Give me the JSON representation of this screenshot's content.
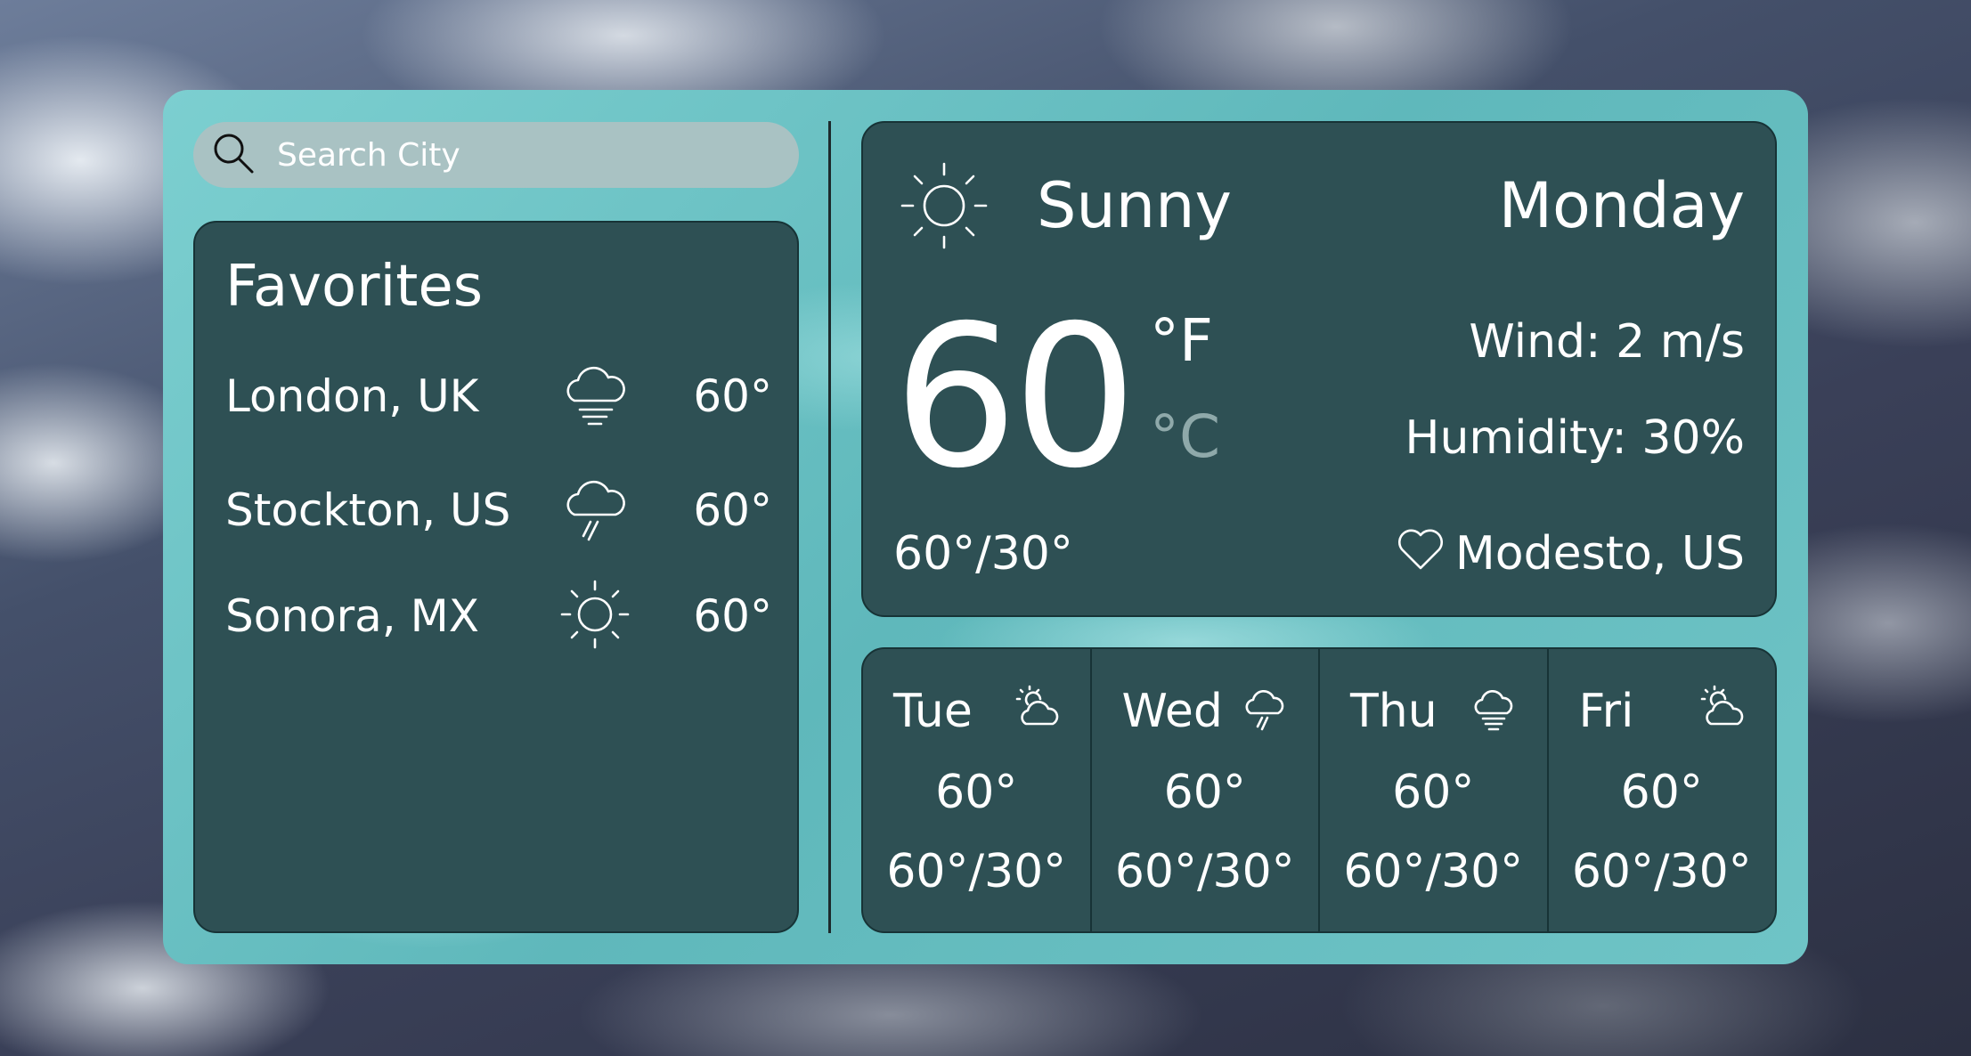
{
  "search": {
    "placeholder": "Search City",
    "icon": "search-icon"
  },
  "favorites": {
    "title": "Favorites",
    "items": [
      {
        "city": "London, UK",
        "icon": "fog-icon",
        "temp": "60°"
      },
      {
        "city": "Stockton, US",
        "icon": "rain-icon",
        "temp": "60°"
      },
      {
        "city": "Sonora, MX",
        "icon": "sun-icon",
        "temp": "60°"
      }
    ]
  },
  "current": {
    "icon": "sun-icon",
    "condition": "Sunny",
    "day": "Monday",
    "temp": "60",
    "unit_f": "°F",
    "unit_c": "°C",
    "wind": "Wind: 2 m/s",
    "humidity": "Humidity: 30%",
    "hilo": "60°/30°",
    "location": "Modesto, US"
  },
  "forecast": [
    {
      "day": "Tue",
      "icon": "partly-cloudy-icon",
      "temp": "60°",
      "hilo": "60°/30°"
    },
    {
      "day": "Wed",
      "icon": "rain-icon",
      "temp": "60°",
      "hilo": "60°/30°"
    },
    {
      "day": "Thu",
      "icon": "fog-icon",
      "temp": "60°",
      "hilo": "60°/30°"
    },
    {
      "day": "Fri",
      "icon": "partly-cloudy-icon",
      "temp": "60°",
      "hilo": "60°/30°"
    }
  ],
  "colors": {
    "panel": "#6fc4c6",
    "card": "#2e5054",
    "search_bg": "#a9c2c3",
    "inactive_unit": "#8fa9aa"
  }
}
